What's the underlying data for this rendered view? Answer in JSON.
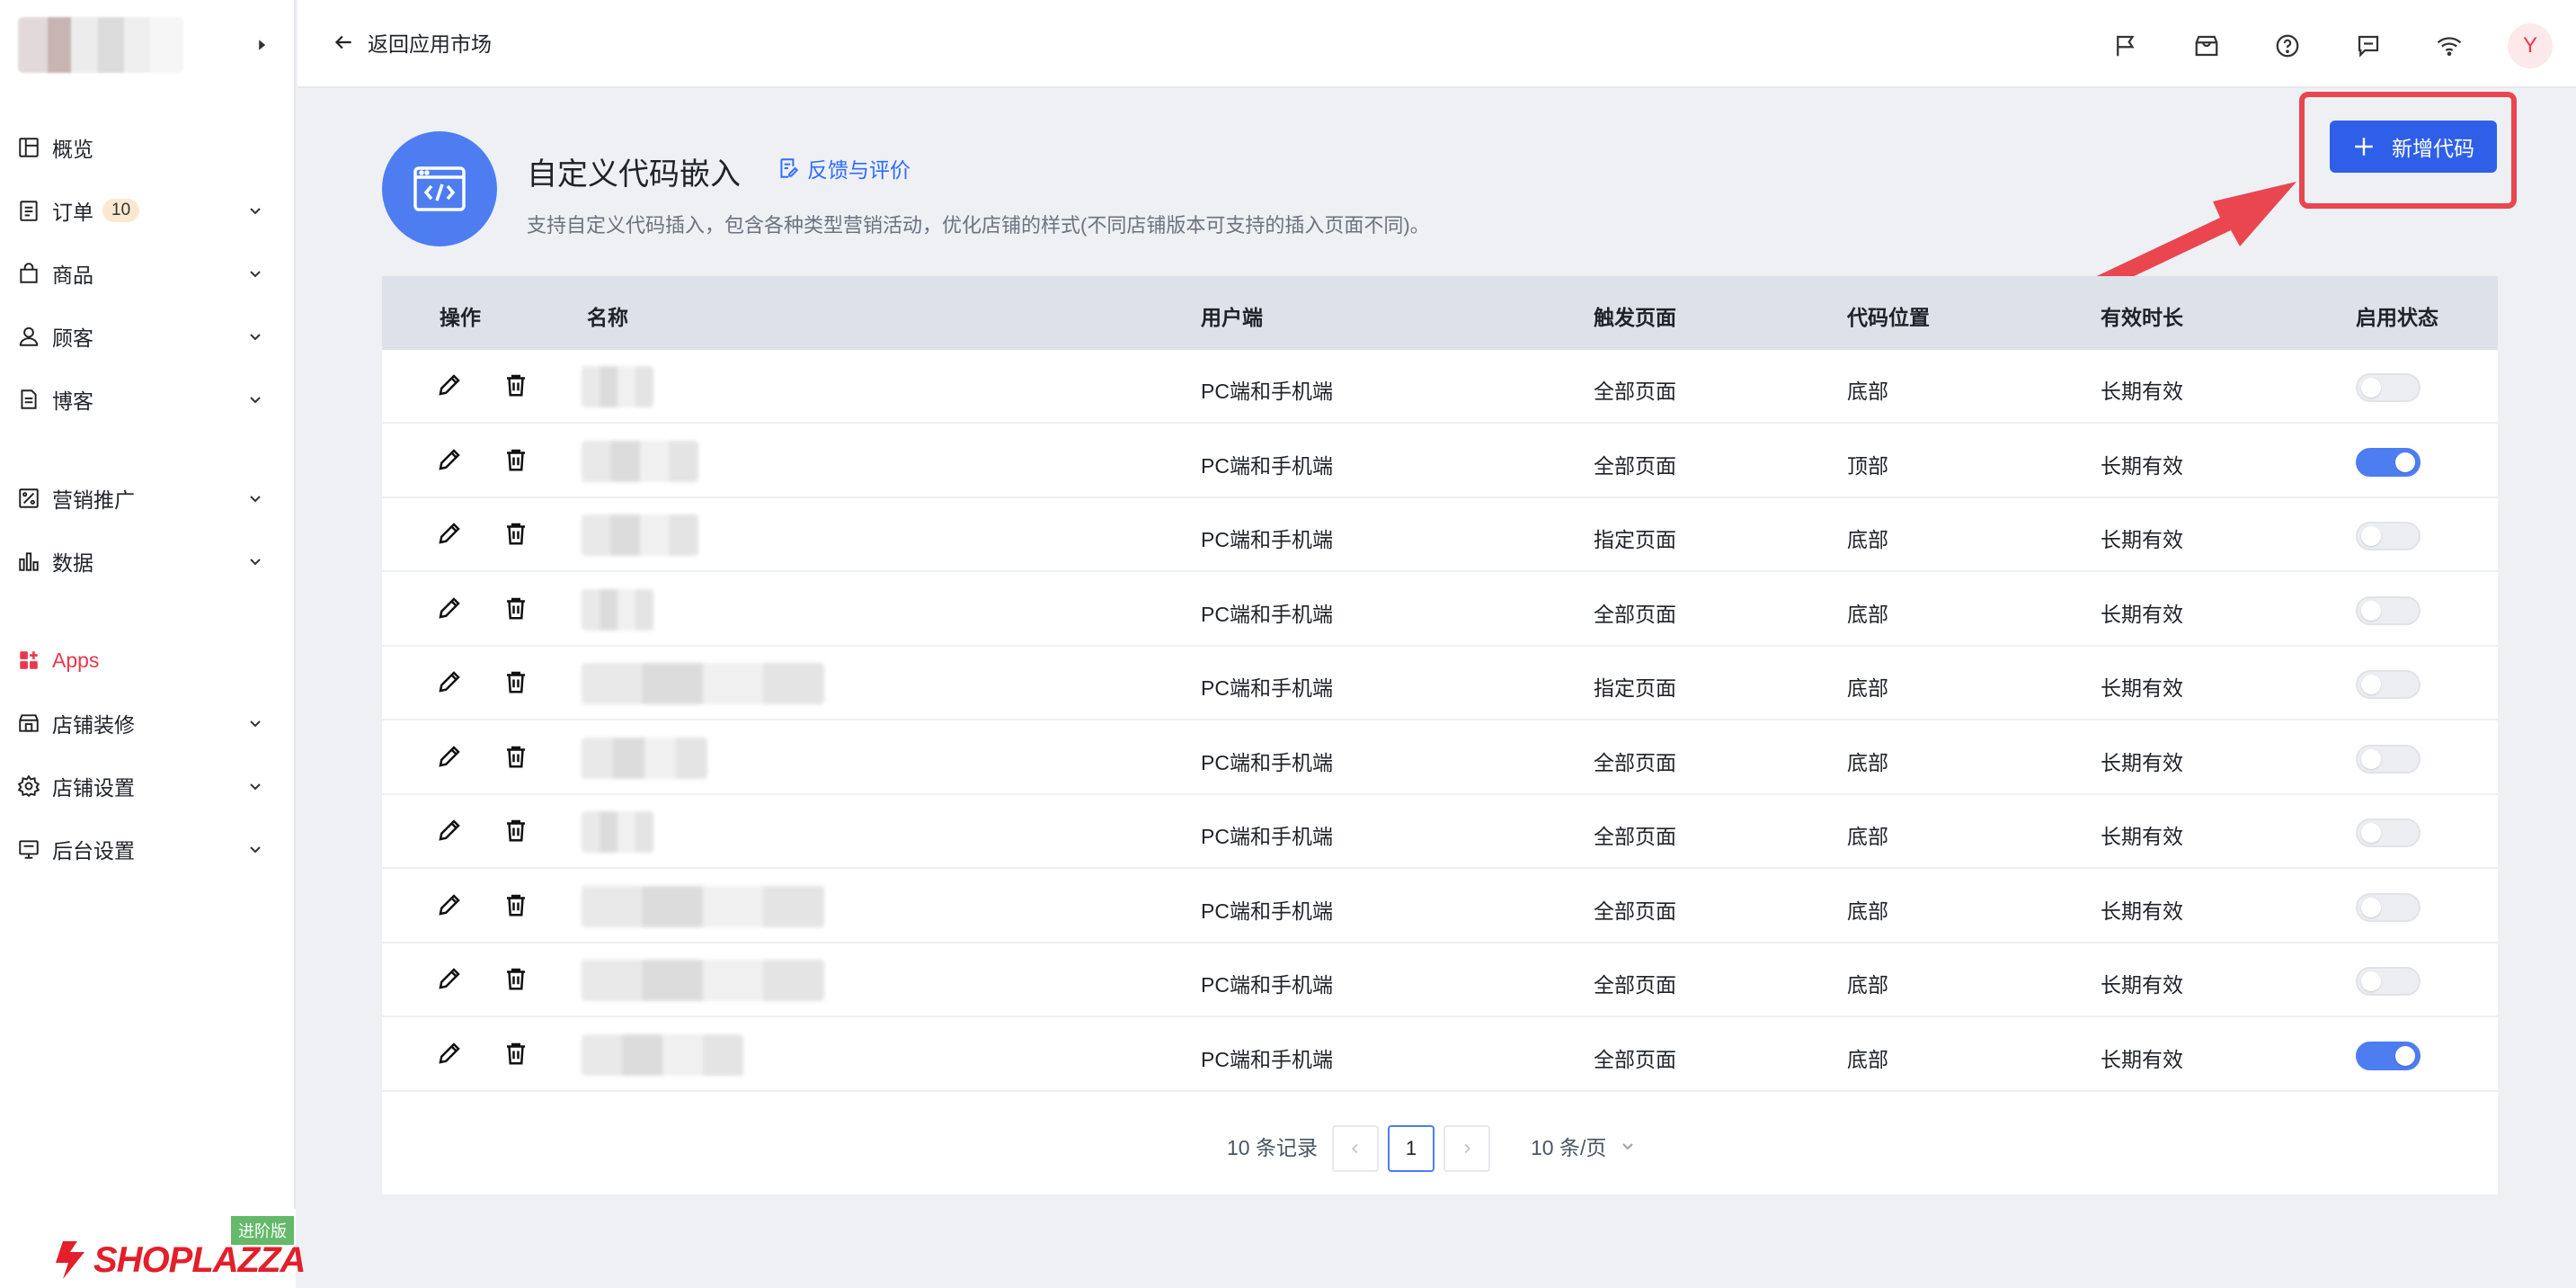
{
  "sidebar": {
    "items": [
      {
        "label": "概览",
        "icon": "dashboard-icon"
      },
      {
        "label": "订单",
        "icon": "orders-icon",
        "badge": "10"
      },
      {
        "label": "商品",
        "icon": "products-icon"
      },
      {
        "label": "顾客",
        "icon": "customers-icon"
      },
      {
        "label": "博客",
        "icon": "blog-icon"
      },
      {
        "label": "营销推广",
        "icon": "marketing-icon"
      },
      {
        "label": "数据",
        "icon": "analytics-icon"
      },
      {
        "label": "Apps",
        "icon": "apps-icon"
      },
      {
        "label": "店铺装修",
        "icon": "store-design-icon"
      },
      {
        "label": "店铺设置",
        "icon": "store-settings-icon"
      },
      {
        "label": "后台设置",
        "icon": "admin-settings-icon"
      }
    ],
    "brand": {
      "name": "SHOPLAZZA",
      "plan_badge": "进阶版"
    }
  },
  "topbar": {
    "back_label": "返回应用市场",
    "avatar_initial": "Y"
  },
  "header": {
    "title": "自定义代码嵌入",
    "feedback_label": "反馈与评价",
    "description": "支持自定义代码插入，包含各种类型营销活动，优化店铺的样式(不同店铺版本可支持的插入页面不同)。",
    "add_button_label": "新增代码"
  },
  "table": {
    "columns": [
      "操作",
      "名称",
      "用户端",
      "触发页面",
      "代码位置",
      "有效时长",
      "启用状态"
    ],
    "rows": [
      {
        "client": "PC端和手机端",
        "page": "全部页面",
        "position": "底部",
        "duration": "长期有效",
        "enabled": false
      },
      {
        "client": "PC端和手机端",
        "page": "全部页面",
        "position": "顶部",
        "duration": "长期有效",
        "enabled": true
      },
      {
        "client": "PC端和手机端",
        "page": "指定页面",
        "position": "底部",
        "duration": "长期有效",
        "enabled": false
      },
      {
        "client": "PC端和手机端",
        "page": "全部页面",
        "position": "底部",
        "duration": "长期有效",
        "enabled": false
      },
      {
        "client": "PC端和手机端",
        "page": "指定页面",
        "position": "底部",
        "duration": "长期有效",
        "enabled": false
      },
      {
        "client": "PC端和手机端",
        "page": "全部页面",
        "position": "底部",
        "duration": "长期有效",
        "enabled": false
      },
      {
        "client": "PC端和手机端",
        "page": "全部页面",
        "position": "底部",
        "duration": "长期有效",
        "enabled": false
      },
      {
        "client": "PC端和手机端",
        "page": "全部页面",
        "position": "底部",
        "duration": "长期有效",
        "enabled": false
      },
      {
        "client": "PC端和手机端",
        "page": "全部页面",
        "position": "底部",
        "duration": "长期有效",
        "enabled": false
      },
      {
        "client": "PC端和手机端",
        "page": "全部页面",
        "position": "底部",
        "duration": "长期有效",
        "enabled": true
      }
    ]
  },
  "pagination": {
    "total_label": "10 条记录",
    "current_page": "1",
    "page_size_label": "10 条/页"
  },
  "colors": {
    "accent": "#2f5fe8",
    "toggle_on": "#4d7df1",
    "highlight_frame": "#e9464f",
    "apps_active": "#e8394a"
  }
}
